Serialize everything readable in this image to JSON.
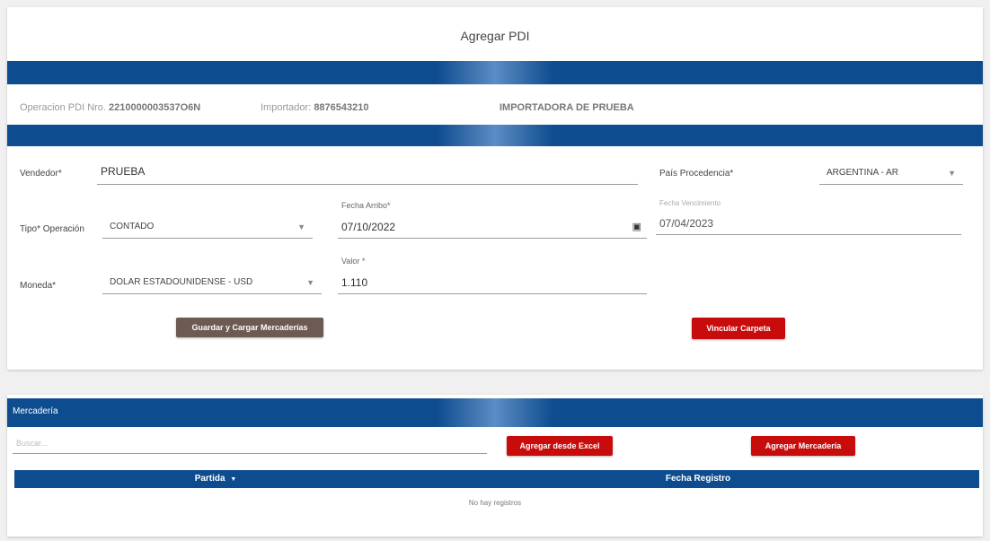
{
  "header": {
    "title": "Agregar PDI"
  },
  "info": {
    "operacion_label": "Operacion PDI Nro.",
    "operacion_value": "2210000003537O6N",
    "importador_label": "Importador:",
    "importador_value": "8876543210",
    "importador_name": "IMPORTADORA DE PRUEBA"
  },
  "form": {
    "vendedor_label": "Vendedor*",
    "vendedor_value": "PRUEBA",
    "pais_label": "País Procedencia*",
    "pais_value": "ARGENTINA - AR",
    "tipo_op_label": "Tipo* Operación",
    "tipo_op_value": "CONTADO",
    "fecha_arribo_label": "Fecha Arribo*",
    "fecha_arribo_value": "07/10/2022",
    "fecha_venc_label": "Fecha Vencimiento",
    "fecha_venc_value": "07/04/2023",
    "moneda_label": "Moneda*",
    "moneda_value": "DOLAR ESTADOUNIDENSE - USD",
    "valor_label": "Valor *",
    "valor_value": "1.110",
    "guardar_button": "Guardar y Cargar Mercaderías",
    "vincular_button": "Vincular Carpeta"
  },
  "mercaderia": {
    "header": "Mercadería",
    "filter_placeholder": "Buscar...",
    "agregar_excel_button": "Agregar desde Excel",
    "agregar_merc_button": "Agregar Mercadería",
    "columns": [
      "Partida",
      "Fecha Registro"
    ],
    "sort_indicator": "▼",
    "empty_text": "No hay registros"
  },
  "colors": {
    "primary": "#0d4c8f",
    "brown": "#6d5a52",
    "red": "#c80c0c"
  },
  "icons": {
    "dropdown": "triangle-down",
    "calendar": "calendar"
  }
}
